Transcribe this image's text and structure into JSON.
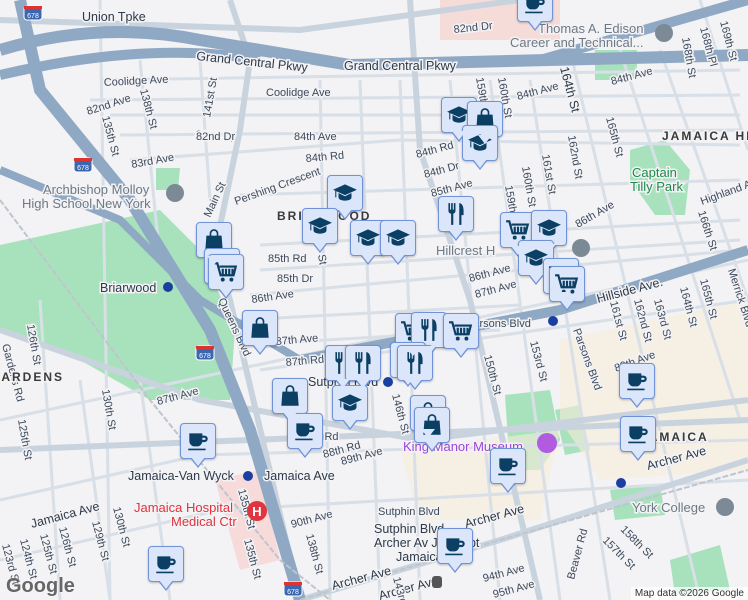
{
  "map": {
    "streets": [
      "Union Tpke",
      "Grand Central Pkwy",
      "Grand Central Pkwy",
      "Coolidge Ave",
      "Coolidge Ave",
      "82nd Ave",
      "138th St",
      "135th St",
      "141st St",
      "82nd Dr",
      "83rd Ave",
      "84th Ave",
      "84th Rd",
      "Pershing Crescent",
      "Main St",
      "85th Rd",
      "85th Dr",
      "86th Ave",
      "Queens Blvd",
      "82nd Dr",
      "82nd Dr",
      "164th St",
      "159th St",
      "160th St",
      "84th Ave",
      "84th Ave",
      "84th Rd",
      "84th Dr",
      "85th Ave",
      "165th St",
      "162nd St",
      "161st St",
      "160th St",
      "159th St",
      "86th Ave",
      "86th Ave",
      "87th Ave",
      "166th St",
      "Highland Ave",
      "Hillside Ave.",
      "Parsons Blvd",
      "Parsons Blvd",
      "87th Ave",
      "87th Rd",
      "150th St",
      "153rd St",
      "161st St",
      "162nd St",
      "163rd St",
      "164th St",
      "165th St",
      "89th Ave",
      "Merrick Blvd",
      "126th St",
      "130th St",
      "125th St",
      "87th Ave",
      "88th Rd",
      "89th Ave",
      "Jamaica Ave",
      "Jamaica Ave",
      "90th Ave",
      "135th St",
      "138th St",
      "Archer Ave",
      "Archer Ave",
      "Archer Ave",
      "Archer Ave",
      "146th St",
      "143rd St",
      "94th Ave",
      "95th Ave",
      "Beaver Rd",
      "157th St",
      "158th St",
      "123rd St",
      "124th St",
      "125th St",
      "126th St",
      "129th St",
      "130th St",
      "Sutphin Blvd",
      "168th St",
      "168th Pl",
      "169th St",
      "Gardens Rd",
      "135th St",
      "St",
      "88th Rd"
    ],
    "pois": {
      "molloy": [
        "Archbishop Molloy",
        "High School New York"
      ],
      "edison": [
        "Thomas A. Edison",
        "Career and Technical..."
      ],
      "hillcrest": "Hillcrest H",
      "york": "York College",
      "kings_manor": "King Manor Museum",
      "hospital": [
        "Jamaica Hospital",
        "Medical Ctr"
      ],
      "captain_tilly": [
        "Captain",
        "Tilly Park"
      ]
    },
    "stations": [
      "Briarwood",
      "Jamaica-Van Wyck",
      "Sutphin Blvd",
      "Sutphin Blvd-",
      "Archer Av JFK Arpt",
      "Jamaica",
      "Parsons Blvd"
    ],
    "neighborhoods": [
      "BRIARWOOD",
      "JAMAICA HILLS",
      "JAMAICA",
      "GARDENS"
    ],
    "highway_shields": [
      "678",
      "678",
      "678",
      "678"
    ],
    "markers": [
      "coffee",
      "school",
      "bag",
      "school",
      "school",
      "school",
      "school",
      "school",
      "bag",
      "cart",
      "cart",
      "food",
      "cart",
      "school",
      "school",
      "cart",
      "cart",
      "bag",
      "cart",
      "food",
      "cart",
      "food",
      "food",
      "food",
      "food",
      "bag",
      "school",
      "coffee",
      "bag",
      "bag",
      "coffee",
      "coffee",
      "coffee",
      "coffee",
      "coffee",
      "coffee"
    ],
    "colors": {
      "background": "#f3f2f4",
      "highway": "#8fa8c4",
      "road": "#d5dde6",
      "park": "#a8e2bd",
      "marker_bg": "#dbe6fb",
      "marker_border": "#6f93d6",
      "icon": "#0b3f63"
    }
  },
  "branding": {
    "logo": "Google",
    "attribution": "Map data ©2026 Google"
  }
}
